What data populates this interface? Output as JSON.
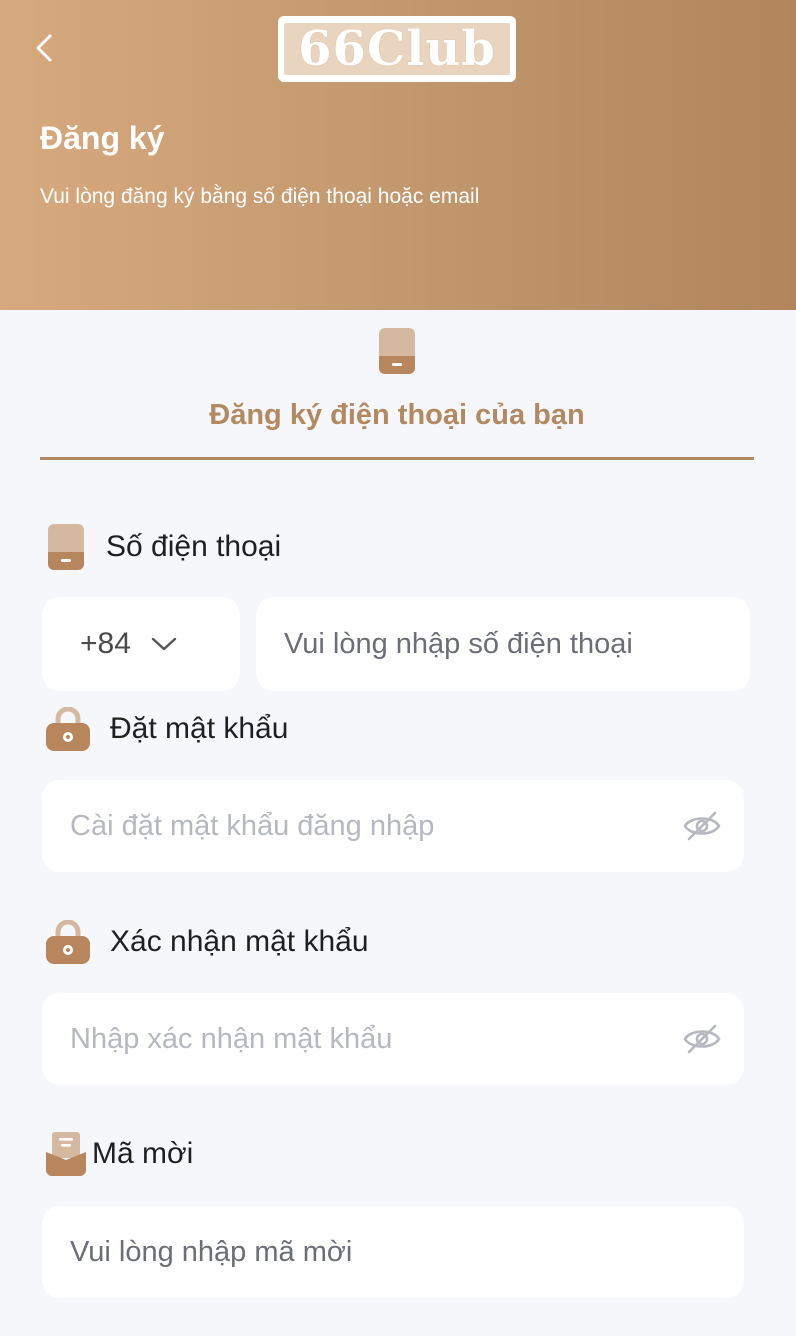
{
  "colors": {
    "brand": "#b28a62",
    "header_start": "#d7a97e",
    "header_end": "#b2855d",
    "background": "#f6f7fb"
  },
  "header": {
    "logo_text": "66Club",
    "title": "Đăng ký",
    "subtitle": "Vui lòng đăng ký bằng số điện thoại hoặc email"
  },
  "tab": {
    "label": "Đăng ký điện thoại của bạn",
    "icon": "phone-icon"
  },
  "form": {
    "phone": {
      "label": "Số điện thoại",
      "icon": "phone-icon",
      "country_code": "+84",
      "placeholder": "Vui lòng nhập số điện thoại"
    },
    "password": {
      "label": "Đặt mật khẩu",
      "icon": "lock-icon",
      "placeholder": "Cài đặt mật khẩu đăng nhập"
    },
    "confirm_password": {
      "label": "Xác nhận mật khẩu",
      "icon": "lock-icon",
      "placeholder": "Nhập xác nhận mật khẩu"
    },
    "invite": {
      "label": "Mã mời",
      "icon": "invitation-icon",
      "placeholder": "Vui lòng nhập mã mời"
    }
  }
}
